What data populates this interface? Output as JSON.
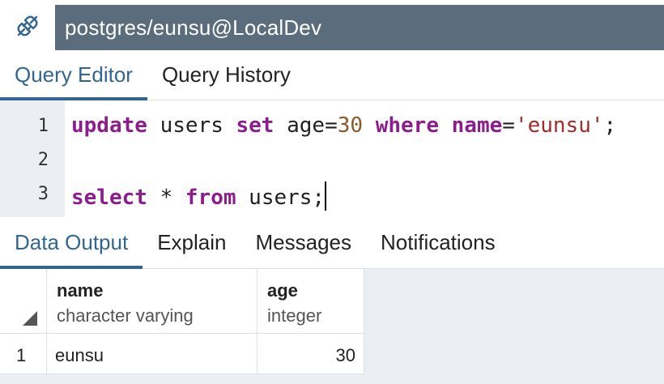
{
  "connection": {
    "title": "postgres/eunsu@LocalDev",
    "icon": "connection-plug-icon"
  },
  "editor_tabs": [
    {
      "label": "Query Editor",
      "active": true
    },
    {
      "label": "Query History",
      "active": false
    }
  ],
  "editor": {
    "line_numbers": [
      "1",
      "2",
      "3"
    ],
    "lines": {
      "l1": {
        "kw_update": "update",
        "t1": " users ",
        "kw_set": "set",
        "t2": " age=",
        "num": "30",
        "t3": " ",
        "kw_where": "where",
        "t4": " ",
        "kw_name": "name",
        "t5": "=",
        "str": "'eunsu'",
        "t6": ";"
      },
      "l3": {
        "kw_select": "select",
        "t1": " * ",
        "kw_from": "from",
        "t2": " users;"
      }
    }
  },
  "output_tabs": [
    {
      "label": "Data Output",
      "active": true
    },
    {
      "label": "Explain",
      "active": false
    },
    {
      "label": "Messages",
      "active": false
    },
    {
      "label": "Notifications",
      "active": false
    }
  ],
  "results": {
    "columns": [
      {
        "name": "name",
        "type": "character varying"
      },
      {
        "name": "age",
        "type": "integer"
      }
    ],
    "rows": [
      {
        "row_num": "1",
        "name": "eunsu",
        "age": "30"
      }
    ]
  },
  "colors": {
    "accent": "#326690",
    "header_bar": "#5b6d7c",
    "gutter": "#ebeef3",
    "keyword": "#8b1d8d",
    "number": "#8b5a2b",
    "string": "#a52a2a"
  }
}
